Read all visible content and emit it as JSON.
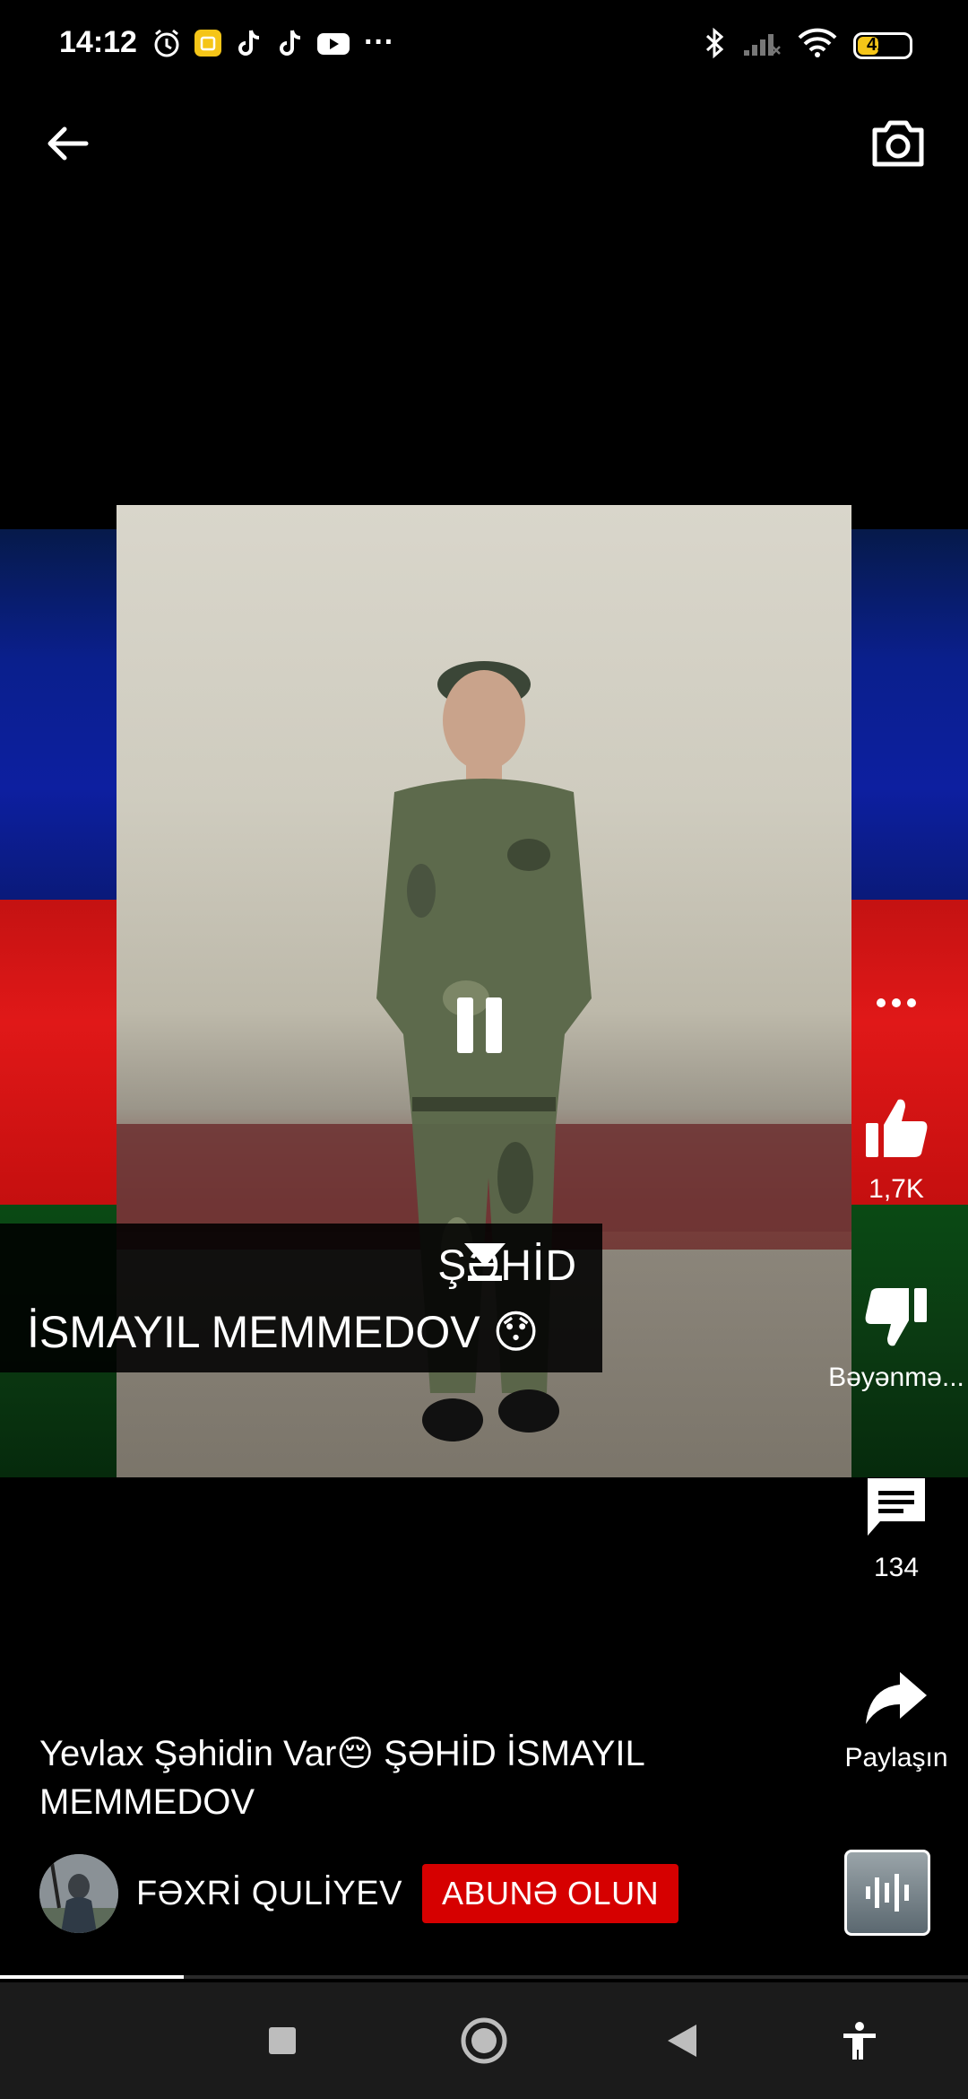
{
  "status_bar": {
    "time": "14:12",
    "battery_level": "41",
    "battery_fraction": 0.41,
    "overflow_glyph": "···",
    "icons": [
      "alarm-icon",
      "app-icon",
      "tiktok-icon",
      "tiktok-icon",
      "youtube-icon",
      "bluetooth-icon",
      "signal-icon",
      "wifi-icon",
      "battery-icon"
    ]
  },
  "header": {
    "back_icon": "back-arrow-icon",
    "camera_icon": "camera-icon"
  },
  "video": {
    "caption_line1": "ŞƏHİD",
    "caption_line2": "İSMAYIL MEMMEDOV 😯",
    "pause_icon": "pause-icon",
    "progress_fraction": 0.19
  },
  "actions": {
    "more_icon": "more-icon",
    "like_count": "1,7K",
    "dislike_label": "Bəyənmə...",
    "comment_count": "134",
    "share_label": "Paylaşın"
  },
  "info": {
    "title": "Yevlax Şəhidin Var😔 ŞƏHİD İSMAYIL MEMMEDOV",
    "channel_name": "FƏXRİ QULİYEV",
    "subscribe_label": "ABUNƏ OLUN"
  },
  "colors": {
    "subscribe_red": "#d60000",
    "battery_yellow": "#f5c518",
    "flag_blue": "#0d1fa0",
    "flag_red": "#e01818",
    "flag_green": "#0b3a12"
  },
  "navbar": {
    "icons": [
      "recents-icon",
      "home-icon",
      "back-icon",
      "accessibility-icon"
    ]
  }
}
